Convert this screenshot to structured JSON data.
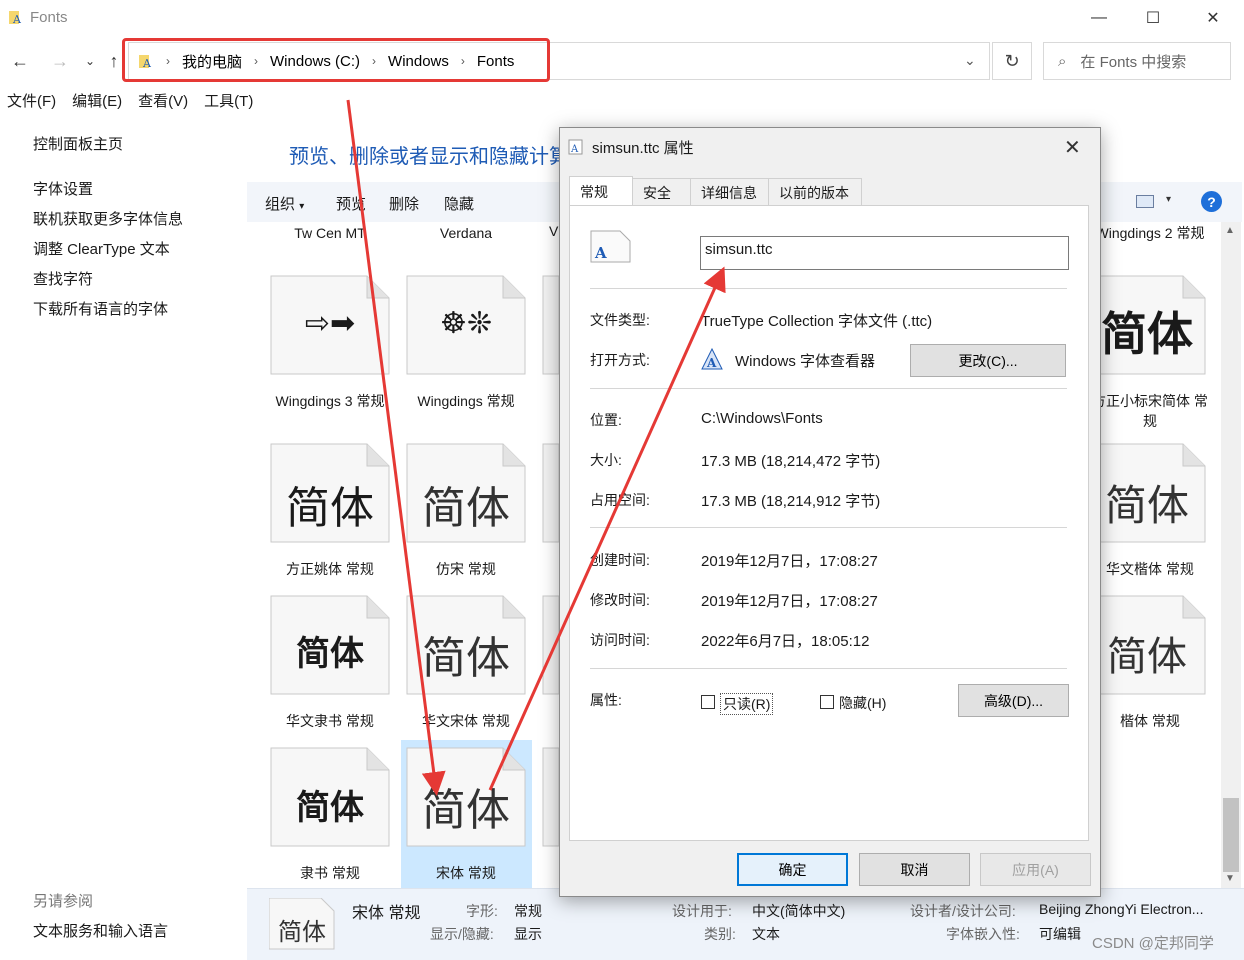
{
  "window": {
    "title": "Fonts"
  },
  "address": {
    "crumbs": [
      "我的电脑",
      "Windows (C:)",
      "Windows",
      "Fonts"
    ],
    "search_placeholder": "在 Fonts 中搜索"
  },
  "menu": [
    "文件(F)",
    "编辑(E)",
    "查看(V)",
    "工具(T)"
  ],
  "left_pane": {
    "home": "控制面板主页",
    "links": [
      "字体设置",
      "联机获取更多字体信息",
      "调整 ClearType 文本",
      "查找字符",
      "下载所有语言的字体"
    ],
    "see_also": "另请参阅",
    "see_also_link": "文本服务和输入语言"
  },
  "main": {
    "heading": "预览、删除或者显示和隐藏计算",
    "toolbar": [
      "组织",
      "预览",
      "删除",
      "隐藏"
    ],
    "top_labels": [
      "Tw Cen MT",
      "Verdana",
      "V",
      "Wingdings 2 常规"
    ],
    "fonts": [
      {
        "glyph": "⇨➡",
        "label": "Wingdings 3 常规"
      },
      {
        "glyph": "☸❊",
        "label": "Wingdings 常规"
      },
      {
        "glyph": "简体",
        "label": "方正小标宋简体 常规"
      },
      {
        "glyph": "简体",
        "label": "方正姚体 常规"
      },
      {
        "glyph": "简体",
        "label": "仿宋 常规"
      },
      {
        "glyph": "简体",
        "label": "华文楷体 常规"
      },
      {
        "glyph": "简体",
        "label": "华文隶书 常规"
      },
      {
        "glyph": "简体",
        "label": "华文宋体 常规"
      },
      {
        "glyph": "简体",
        "label": "楷体 常规"
      },
      {
        "glyph": "简体",
        "label": "隶书 常规"
      },
      {
        "glyph": "简体",
        "label": "宋体 常规"
      }
    ]
  },
  "details": {
    "glyph": "简体",
    "name": "宋体 常规",
    "style_label": "字形:",
    "style_value": "常规",
    "show_label": "显示/隐藏:",
    "show_value": "显示",
    "design_label": "设计用于:",
    "design_value": "中文(简体中文)",
    "category_label": "类别:",
    "category_value": "文本",
    "designer_label": "设计者/设计公司:",
    "designer_value": "Beijing ZhongYi Electron...",
    "embed_label": "字体嵌入性:",
    "embed_value": "可编辑"
  },
  "dialog": {
    "title": "simsun.ttc 属性",
    "tabs": [
      "常规",
      "安全",
      "详细信息",
      "以前的版本"
    ],
    "filename": "simsun.ttc",
    "rows": {
      "type_label": "文件类型:",
      "type_value": "TrueType Collection 字体文件 (.ttc)",
      "open_label": "打开方式:",
      "open_value": "Windows 字体查看器",
      "change_btn": "更改(C)...",
      "loc_label": "位置:",
      "loc_value": "C:\\Windows\\Fonts",
      "size_label": "大小:",
      "size_value": "17.3 MB (18,214,472 字节)",
      "disk_label": "占用空间:",
      "disk_value": "17.3 MB (18,214,912 字节)",
      "created_label": "创建时间:",
      "created_value": "2019年12月7日，17:08:27",
      "modified_label": "修改时间:",
      "modified_value": "2019年12月7日，17:08:27",
      "accessed_label": "访问时间:",
      "accessed_value": "2022年6月7日，18:05:12",
      "attr_label": "属性:",
      "readonly": "只读(R)",
      "hidden": "隐藏(H)",
      "advanced_btn": "高级(D)..."
    },
    "buttons": {
      "ok": "确定",
      "cancel": "取消",
      "apply": "应用(A)"
    }
  },
  "watermark": "CSDN @定邦同学",
  "colors": {
    "accent_blue": "#1e5bb5",
    "annotation_red": "#e53935",
    "selection": "#cce8ff"
  }
}
